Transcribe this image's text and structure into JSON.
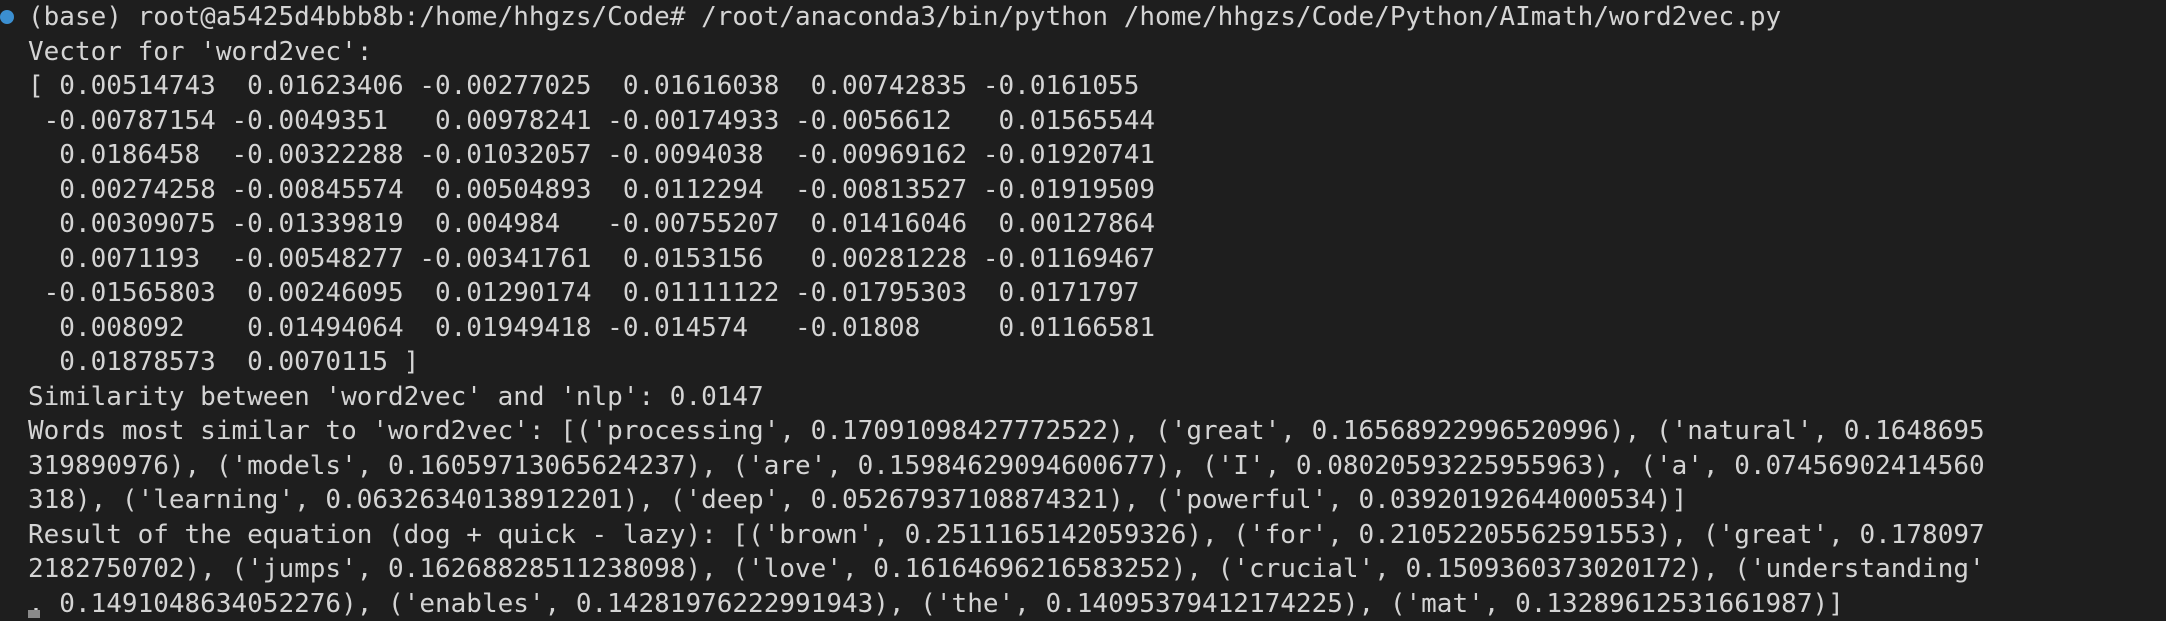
{
  "terminal": {
    "status_dot_color": "#3b8fd1",
    "lines": [
      "(base) root@a5425d4bbb8b:/home/hhgzs/Code# /root/anaconda3/bin/python /home/hhgzs/Code/Python/AImath/word2vec.py",
      "Vector for 'word2vec':",
      "[ 0.00514743  0.01623406 -0.00277025  0.01616038  0.00742835 -0.0161055",
      " -0.00787154 -0.0049351   0.00978241 -0.00174933 -0.0056612   0.01565544",
      "  0.0186458  -0.00322288 -0.01032057 -0.0094038  -0.00969162 -0.01920741",
      "  0.00274258 -0.00845574  0.00504893  0.0112294  -0.00813527 -0.01919509",
      "  0.00309075 -0.01339819  0.004984   -0.00755207  0.01416046  0.00127864",
      "  0.0071193  -0.00548277 -0.00341761  0.0153156   0.00281228 -0.01169467",
      " -0.01565803  0.00246095  0.01290174  0.01111122 -0.01795303  0.0171797",
      "  0.008092    0.01494064  0.01949418 -0.014574   -0.01808     0.01166581",
      "  0.01878573  0.0070115 ]",
      "Similarity between 'word2vec' and 'nlp': 0.0147",
      "Words most similar to 'word2vec': [('processing', 0.17091098427772522), ('great', 0.16568922996520996), ('natural', 0.1648695",
      "319890976), ('models', 0.16059713065624237), ('are', 0.15984629094600677), ('I', 0.08020593225955963), ('a', 0.07456902414560",
      "318), ('learning', 0.06326340138912201), ('deep', 0.05267937108874321), ('powerful', 0.03920192644000534)]",
      "Result of the equation (dog + quick - lazy): [('brown', 0.2511165142059326), ('for', 0.21052205562591553), ('great', 0.178097",
      "2182750702), ('jumps', 0.16268828511238098), ('love', 0.16164696216583252), ('crucial', 0.1509360373020172), ('understanding'",
      ", 0.1491048634052276), ('enables', 0.14281976222991943), ('the', 0.14095379412174225), ('mat', 0.13289612531661987)]"
    ]
  }
}
